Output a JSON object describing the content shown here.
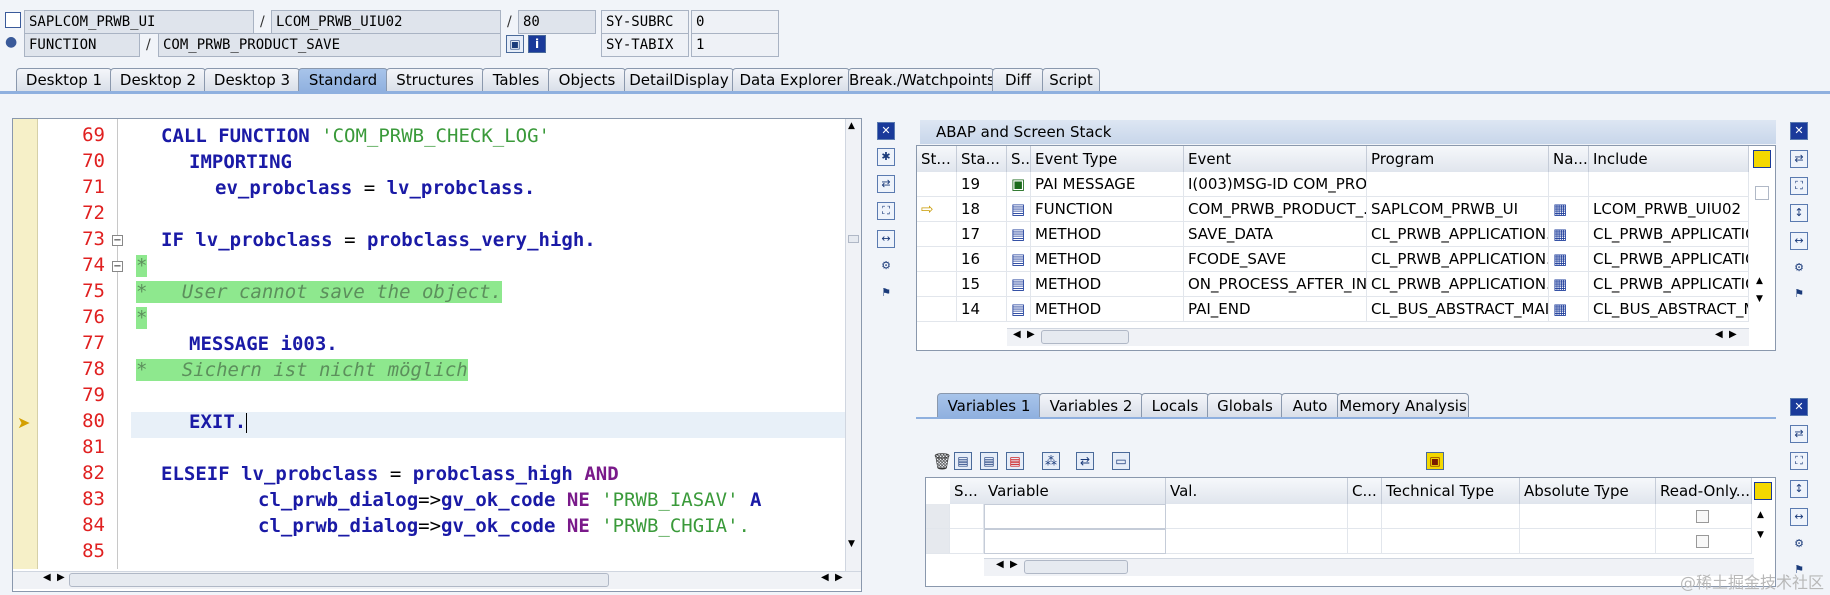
{
  "header": {
    "row1": {
      "program": "SAPLCOM_PRWB_UI",
      "include": "LCOM_PRWB_UIU02",
      "line": "80",
      "sysfield_name": "SY-SUBRC",
      "sysfield_value": "0"
    },
    "row2": {
      "event_type": "FUNCTION",
      "event": "COM_PRWB_PRODUCT_SAVE",
      "sysfield_name": "SY-TABIX",
      "sysfield_value": "1"
    },
    "separator": "/"
  },
  "tabs": [
    "Desktop 1",
    "Desktop 2",
    "Desktop 3",
    "Standard",
    "Structures",
    "Tables",
    "Objects",
    "DetailDisplay",
    "Data Explorer",
    "Break./Watchpoints",
    "Diff",
    "Script"
  ],
  "active_tab": "Standard",
  "code": {
    "lines": [
      {
        "num": "69"
      },
      {
        "num": "70"
      },
      {
        "num": "71"
      },
      {
        "num": "72"
      },
      {
        "num": "73"
      },
      {
        "num": "74"
      },
      {
        "num": "75"
      },
      {
        "num": "76"
      },
      {
        "num": "77"
      },
      {
        "num": "78"
      },
      {
        "num": "79"
      },
      {
        "num": "80"
      },
      {
        "num": "81"
      },
      {
        "num": "82"
      },
      {
        "num": "83"
      },
      {
        "num": "84"
      },
      {
        "num": "85"
      }
    ],
    "tokens": {
      "l69_kw1": "CALL FUNCTION",
      "l69_str": "'COM_PRWB_CHECK_LOG'",
      "l70_kw": "IMPORTING",
      "l71_a": "ev_probclass",
      "l71_eq": " = ",
      "l71_b": "lv_probclass.",
      "l73_kw": "IF",
      "l73_a": "lv_probclass",
      "l73_eq": " = ",
      "l73_b": "probclass_very_high.",
      "l74_cmt": "*",
      "l75_cmt": "*   User cannot save the object.",
      "l76_cmt": "*",
      "l77_kw": "MESSAGE",
      "l77_a": "i003.",
      "l78_cmt": "*   Sichern ist nicht möglich",
      "l80_kw": "EXIT.",
      "l82_kw": "ELSEIF",
      "l82_a": "lv_probclass",
      "l82_eq": " = ",
      "l82_b": "probclass_high",
      "l82_kw2": "AND",
      "l83_a": "cl_prwb_dialog",
      "l83_arrow": "=>",
      "l83_b": "gv_ok_code",
      "l83_kw": "NE",
      "l83_str": "'PRWB_IASAV'",
      "l83_tail": "A",
      "l84_a": "cl_prwb_dialog",
      "l84_arrow": "=>",
      "l84_b": "gv_ok_code",
      "l84_kw": "NE",
      "l84_str": "'PRWB_CHGIA'."
    }
  },
  "stack": {
    "title": "ABAP and Screen Stack",
    "columns": [
      "St...",
      "Sta...",
      "S...",
      "Event Type",
      "Event",
      "Program",
      "Na...",
      "Include"
    ],
    "rows": [
      {
        "level": "19",
        "type": "PAI MESSAGE",
        "event": "I(003)MSG-ID COM_PRO...",
        "program": "",
        "include": ""
      },
      {
        "level": "18",
        "type": "FUNCTION",
        "event": "COM_PRWB_PRODUCT_...",
        "program": "SAPLCOM_PRWB_UI",
        "include": "LCOM_PRWB_UIU02"
      },
      {
        "level": "17",
        "type": "METHOD",
        "event": "SAVE_DATA",
        "program": "CL_PRWB_APPLICATION...",
        "include": "CL_PRWB_APPLICATION..."
      },
      {
        "level": "16",
        "type": "METHOD",
        "event": "FCODE_SAVE",
        "program": "CL_PRWB_APPLICATION...",
        "include": "CL_PRWB_APPLICATION..."
      },
      {
        "level": "15",
        "type": "METHOD",
        "event": "ON_PROCESS_AFTER_IN...",
        "program": "CL_PRWB_APPLICATION...",
        "include": "CL_PRWB_APPLICATION..."
      },
      {
        "level": "14",
        "type": "METHOD",
        "event": "PAI_END",
        "program": "CL_BUS_ABSTRACT_MAI...",
        "include": "CL_BUS_ABSTRACT_MAI..."
      }
    ]
  },
  "var_tabs": [
    "Variables 1",
    "Variables 2",
    "Locals",
    "Globals",
    "Auto",
    "Memory Analysis"
  ],
  "var_table": {
    "columns": [
      "S...",
      "Variable",
      "Val.",
      "C...",
      "Technical Type",
      "Absolute Type",
      "Read-Only..."
    ]
  },
  "watermark": "@稀土掘金技术社区"
}
